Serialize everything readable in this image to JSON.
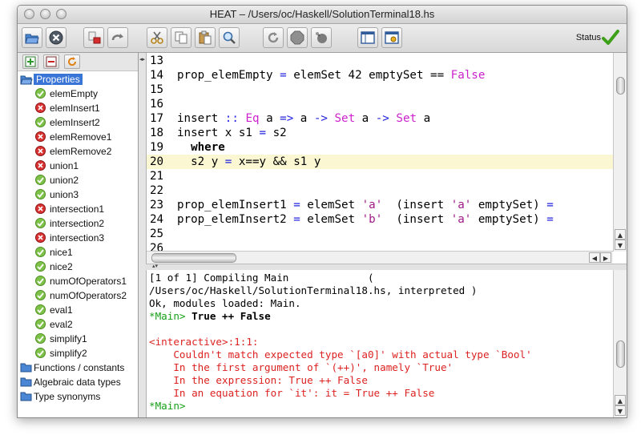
{
  "window": {
    "title": "HEAT – /Users/oc/Haskell/SolutionTerminal18.hs"
  },
  "toolbar": {
    "buttons": [
      {
        "name": "open-icon"
      },
      {
        "name": "close-icon"
      },
      {
        "name": "stop-run-icon"
      },
      {
        "name": "redo-icon"
      },
      {
        "name": "cut-icon"
      },
      {
        "name": "copy-icon"
      },
      {
        "name": "paste-icon"
      },
      {
        "name": "search-icon"
      },
      {
        "name": "reload-icon"
      },
      {
        "name": "stop-icon"
      },
      {
        "name": "interrupt-icon"
      },
      {
        "name": "layout-icon"
      },
      {
        "name": "options-icon"
      }
    ],
    "status_label": "Status",
    "status_icon": "check-icon",
    "accent": "#3ea018"
  },
  "sidebar": {
    "tools": [
      {
        "name": "add-test-icon"
      },
      {
        "name": "remove-test-icon"
      },
      {
        "name": "refresh-icon"
      }
    ],
    "root": "Properties",
    "properties": [
      {
        "label": "elemEmpty",
        "status": "ok"
      },
      {
        "label": "elemInsert1",
        "status": "error"
      },
      {
        "label": "elemInsert2",
        "status": "ok"
      },
      {
        "label": "elemRemove1",
        "status": "error"
      },
      {
        "label": "elemRemove2",
        "status": "error"
      },
      {
        "label": "union1",
        "status": "error"
      },
      {
        "label": "union2",
        "status": "ok"
      },
      {
        "label": "union3",
        "status": "ok"
      },
      {
        "label": "intersection1",
        "status": "error"
      },
      {
        "label": "intersection2",
        "status": "ok"
      },
      {
        "label": "intersection3",
        "status": "error"
      },
      {
        "label": "nice1",
        "status": "ok"
      },
      {
        "label": "nice2",
        "status": "ok"
      },
      {
        "label": "numOfOperators1",
        "status": "ok"
      },
      {
        "label": "numOfOperators2",
        "status": "ok"
      },
      {
        "label": "eval1",
        "status": "ok"
      },
      {
        "label": "eval2",
        "status": "ok"
      },
      {
        "label": "simplify1",
        "status": "ok"
      },
      {
        "label": "simplify2",
        "status": "ok"
      }
    ],
    "groups": [
      "Functions / constants",
      "Algebraic data types",
      "Type synonyms"
    ]
  },
  "editor": {
    "highlight_line": "20",
    "lines": [
      {
        "n": "13",
        "seg": []
      },
      {
        "n": "14",
        "seg": [
          {
            "t": "prop_elemEmpty "
          },
          {
            "t": "=",
            "c": "kw"
          },
          {
            "t": " elemSet 42 emptySet == "
          },
          {
            "t": "False",
            "c": "ty"
          }
        ]
      },
      {
        "n": "15",
        "seg": []
      },
      {
        "n": "16",
        "seg": []
      },
      {
        "n": "17",
        "seg": [
          {
            "t": "insert "
          },
          {
            "t": "::",
            "c": "kw"
          },
          {
            "t": " "
          },
          {
            "t": "Eq",
            "c": "ty"
          },
          {
            "t": " a "
          },
          {
            "t": "=>",
            "c": "kw"
          },
          {
            "t": " a "
          },
          {
            "t": "->",
            "c": "kw"
          },
          {
            "t": " "
          },
          {
            "t": "Set",
            "c": "ty"
          },
          {
            "t": " a "
          },
          {
            "t": "->",
            "c": "kw"
          },
          {
            "t": " "
          },
          {
            "t": "Set",
            "c": "ty"
          },
          {
            "t": " a"
          }
        ]
      },
      {
        "n": "18",
        "seg": [
          {
            "t": "insert x s1 "
          },
          {
            "t": "=",
            "c": "kw"
          },
          {
            "t": " s2"
          }
        ]
      },
      {
        "n": "19",
        "seg": [
          {
            "t": "  "
          },
          {
            "t": "where",
            "c": "bold"
          }
        ]
      },
      {
        "n": "20",
        "seg": [
          {
            "t": "  s2 y "
          },
          {
            "t": "=",
            "c": "kw"
          },
          {
            "t": " x==y && s1 y"
          }
        ]
      },
      {
        "n": "21",
        "seg": []
      },
      {
        "n": "22",
        "seg": []
      },
      {
        "n": "23",
        "seg": [
          {
            "t": "prop_elemInsert1 "
          },
          {
            "t": "=",
            "c": "kw"
          },
          {
            "t": " elemSet "
          },
          {
            "t": "'a'",
            "c": "st"
          },
          {
            "t": "  (insert "
          },
          {
            "t": "'a'",
            "c": "st"
          },
          {
            "t": " emptySet) "
          },
          {
            "t": "=",
            "c": "kw"
          }
        ]
      },
      {
        "n": "24",
        "seg": [
          {
            "t": "prop_elemInsert2 "
          },
          {
            "t": "=",
            "c": "kw"
          },
          {
            "t": " elemSet "
          },
          {
            "t": "'b'",
            "c": "st"
          },
          {
            "t": "  (insert "
          },
          {
            "t": "'a'",
            "c": "st"
          },
          {
            "t": " emptySet) "
          },
          {
            "t": "=",
            "c": "kw"
          }
        ]
      },
      {
        "n": "25",
        "seg": []
      },
      {
        "n": "26",
        "seg": []
      }
    ]
  },
  "console": {
    "lines": [
      {
        "c": "",
        "t": "[1 of 1] Compiling Main             ("
      },
      {
        "c": "",
        "t": "/Users/oc/Haskell/SolutionTerminal18.hs, interpreted )"
      },
      {
        "c": "",
        "t": "Ok, modules loaded: Main."
      },
      {
        "c": "green",
        "t": "*Main>",
        "rest": " True ++ False"
      },
      {
        "c": "",
        "t": ""
      },
      {
        "c": "red",
        "t": "<interactive>:1:1:"
      },
      {
        "c": "red",
        "t": "    Couldn't match expected type `[a0]' with actual type `Bool'"
      },
      {
        "c": "red",
        "t": "    In the first argument of `(++)', namely `True'"
      },
      {
        "c": "red",
        "t": "    In the expression: True ++ False"
      },
      {
        "c": "red",
        "t": "    In an equation for `it': it = True ++ False"
      },
      {
        "c": "green",
        "t": "*Main>",
        "rest": ""
      }
    ]
  }
}
